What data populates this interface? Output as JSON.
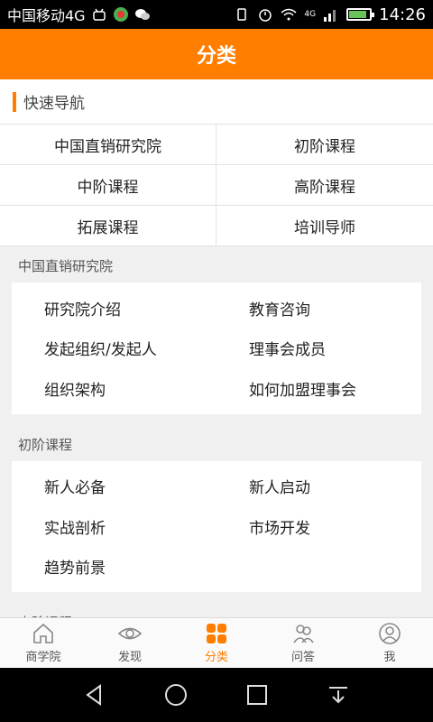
{
  "status_bar": {
    "carrier": "中国移动4G",
    "network": "4G",
    "time": "14:26"
  },
  "header": {
    "title": "分类"
  },
  "quick_nav": {
    "title": "快速导航",
    "items": [
      "中国直销研究院",
      "初阶课程",
      "中阶课程",
      "高阶课程",
      "拓展课程",
      "培训导师"
    ]
  },
  "sections": [
    {
      "title": "中国直销研究院",
      "items": [
        "研究院介绍",
        "教育咨询",
        "发起组织/发起人",
        "理事会成员",
        "组织架构",
        "如何加盟理事会"
      ]
    },
    {
      "title": "初阶课程",
      "items": [
        "新人必备",
        "新人启动",
        "实战剖析",
        "市场开发",
        "趋势前景"
      ]
    },
    {
      "title": "中阶课程",
      "items": []
    }
  ],
  "tabs": [
    {
      "label": "商学院",
      "icon": "home-icon",
      "active": false
    },
    {
      "label": "发现",
      "icon": "eye-icon",
      "active": false
    },
    {
      "label": "分类",
      "icon": "grid-icon",
      "active": true
    },
    {
      "label": "问答",
      "icon": "people-icon",
      "active": false
    },
    {
      "label": "我",
      "icon": "user-icon",
      "active": false
    }
  ],
  "colors": {
    "accent": "#ff7e00",
    "background": "#f0f0f0"
  }
}
